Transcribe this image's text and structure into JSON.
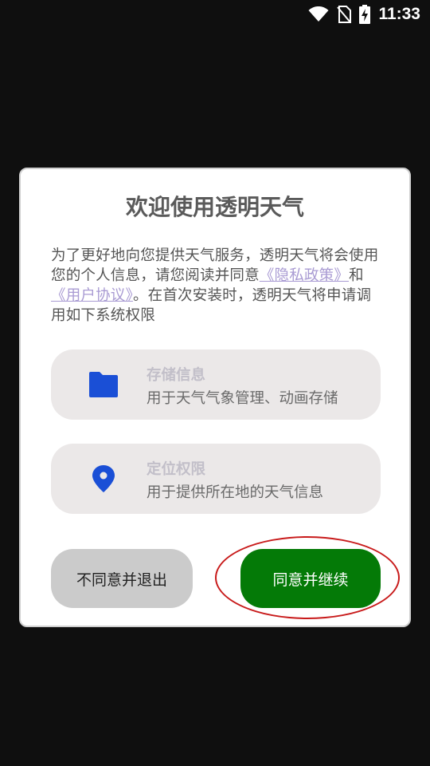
{
  "status_bar": {
    "time": "11:33",
    "icons": [
      "wifi-icon",
      "no-sim-icon",
      "battery-charging-icon"
    ]
  },
  "dialog": {
    "title": "欢迎使用透明天气",
    "description": {
      "part1": "为了更好地向您提供天气服务，透明天气将会使用您的个人信息，请您阅读并同意",
      "privacy_link": "《隐私政策》",
      "and": "和",
      "agreement_link": "《用户协议》",
      "part2": "。在首次安装时，透明天气将申请调用如下系统权限"
    },
    "permissions": [
      {
        "icon": "folder-icon",
        "title": "存储信息",
        "description": "用于天气气象管理、动画存储"
      },
      {
        "icon": "location-pin-icon",
        "title": "定位权限",
        "description": "用于提供所在地的天气信息"
      }
    ],
    "buttons": {
      "exit_label": "不同意并退出",
      "agree_label": "同意并继续"
    }
  },
  "colors": {
    "primary_button": "#047a07",
    "secondary_button": "#cbcbcb",
    "link": "#a99bd3",
    "icon_blue": "#1a4fd6",
    "highlight": "#c81a1a"
  }
}
